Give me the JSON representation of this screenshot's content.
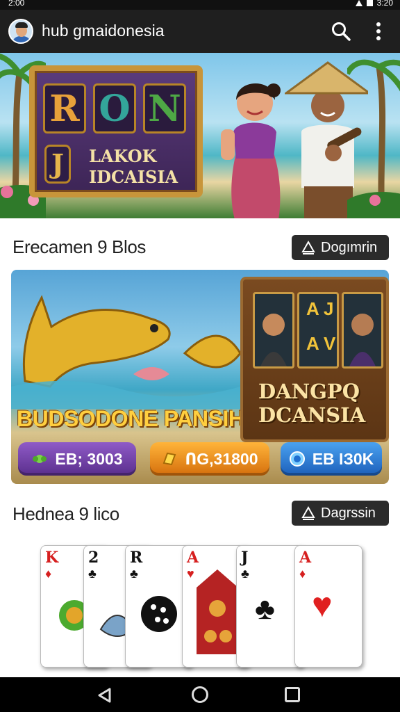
{
  "status_bar": {
    "time": "2:00",
    "right_text": "3:20"
  },
  "app_bar": {
    "title": "hub gmaidonesia",
    "search_icon": "search-icon",
    "menu_icon": "more-vert-icon"
  },
  "hero": {
    "reel_letters": [
      "R",
      "O",
      "N"
    ],
    "reel_colors": [
      "#e8a13a",
      "#33a59a",
      "#4ea845"
    ],
    "side_letter": "J",
    "subtitle": "LAKOK IDCAISIA"
  },
  "sections": [
    {
      "title": "Erecamen 9 Blos",
      "button_label": "Dogımrin"
    },
    {
      "title": "Hednea 9 lico",
      "button_label": "Dagrssin"
    }
  ],
  "game_banner": {
    "title": "BUDSODONE PANSIH",
    "slot_label": "DANGPQ DCANSIA",
    "slot_symbols": [
      "A",
      "J",
      "A",
      "V"
    ],
    "pills": [
      {
        "label": "EB; 3003",
        "icon": "leaf-icon",
        "color": "#6b3aa3"
      },
      {
        "label": "ՈG,31800",
        "icon": "gold-bar-icon",
        "color": "#e9860f"
      },
      {
        "label": "EB ΙЗ0K",
        "icon": "blue-coin-icon",
        "color": "#2c78d4"
      }
    ]
  },
  "cards": [
    {
      "rank": "K",
      "suit": "♦",
      "color": "#d61f1f"
    },
    {
      "rank": "2",
      "suit": "♣",
      "color": "#111111"
    },
    {
      "rank": "R",
      "suit": "♣",
      "color": "#111111"
    },
    {
      "rank": "A",
      "suit": "♥",
      "color": "#d61f1f"
    },
    {
      "rank": "J",
      "suit": "♣",
      "color": "#111111"
    },
    {
      "rank": "A",
      "suit": "♦",
      "color": "#d61f1f"
    }
  ],
  "nav": {
    "back_icon": "back-icon",
    "home_icon": "home-icon",
    "recent_icon": "recent-apps-icon"
  }
}
